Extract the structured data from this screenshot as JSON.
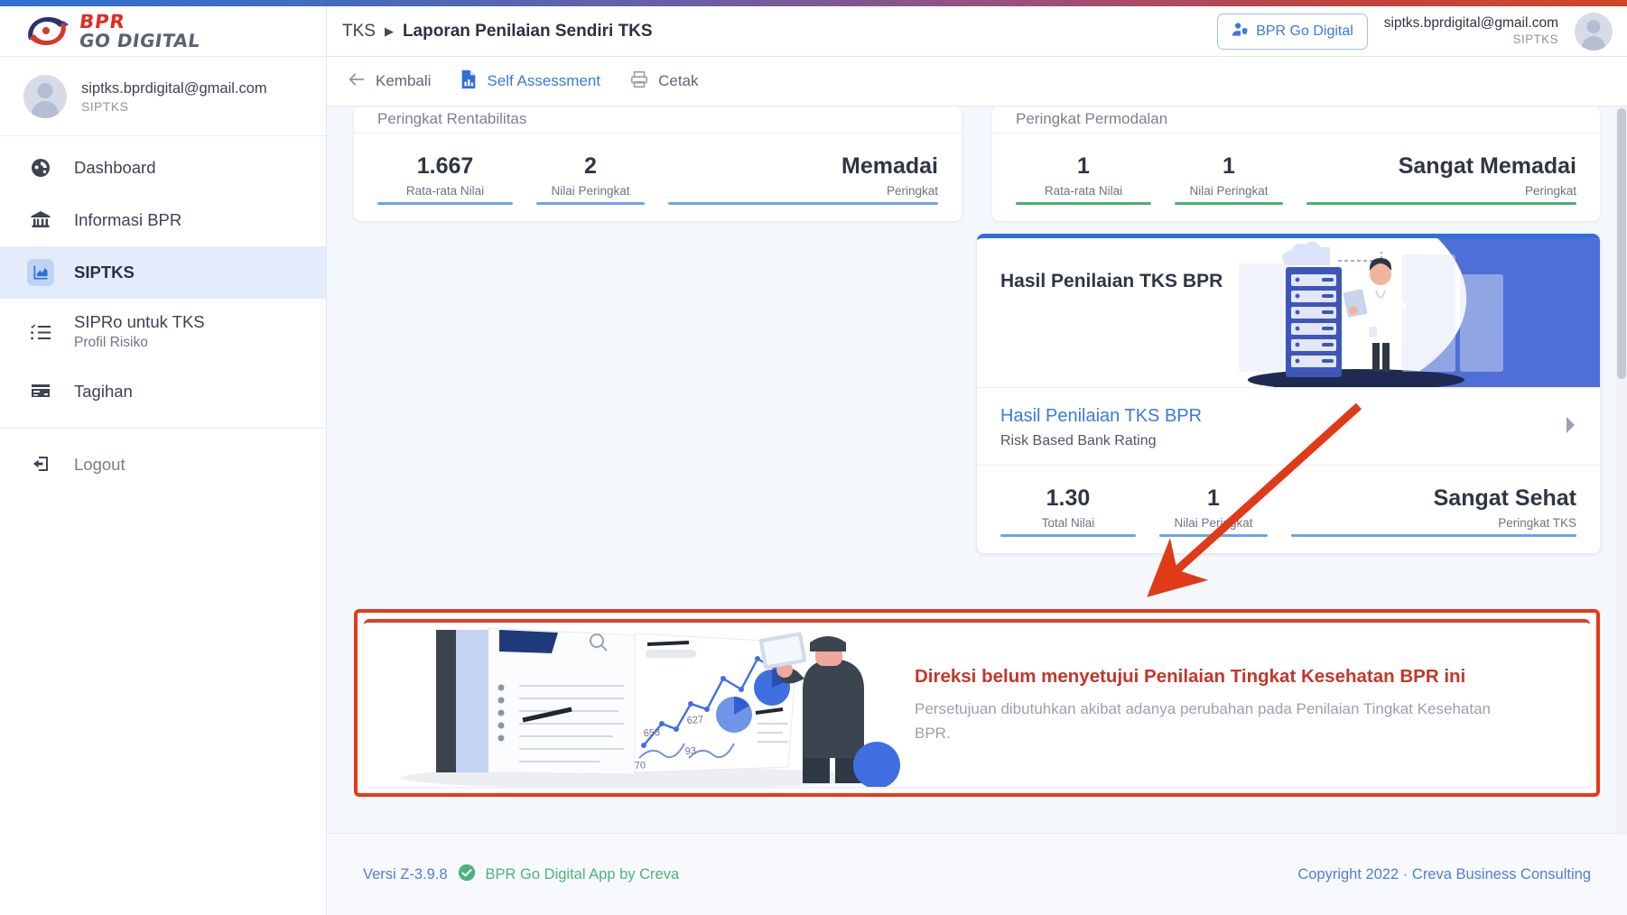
{
  "brand": {
    "line1": "BPR",
    "line2": "GO DIGITAL",
    "logo_icon": "bpr-swoosh-logo"
  },
  "sidebar": {
    "user": {
      "email": "siptks.bprdigital@gmail.com",
      "role": "SIPTKS",
      "avatar_icon": "user-avatar-icon"
    },
    "items": [
      {
        "label": "Dashboard",
        "icon": "dashboard-gauge-icon",
        "sub": "",
        "active": false
      },
      {
        "label": "Informasi BPR",
        "icon": "bank-building-icon",
        "sub": "",
        "active": false
      },
      {
        "label": "SIPTKS",
        "icon": "chart-area-icon",
        "sub": "",
        "active": true
      },
      {
        "label": "SIPRo untuk TKS",
        "icon": "checklist-icon",
        "sub": "Profil Risiko",
        "active": false
      },
      {
        "label": "Tagihan",
        "icon": "credit-card-icon",
        "sub": "",
        "active": false
      }
    ],
    "logout": {
      "label": "Logout",
      "icon": "logout-icon"
    }
  },
  "header": {
    "breadcrumb_root": "TKS",
    "breadcrumb_separator": "▶",
    "breadcrumb_leaf": "Laporan Penilaian Sendiri TKS",
    "go_digital_button": "BPR Go Digital",
    "go_digital_icon": "user-shield-icon",
    "user_email": "siptks.bprdigital@gmail.com",
    "user_role": "SIPTKS",
    "avatar_icon": "user-avatar-icon"
  },
  "toolbar": {
    "back": {
      "label": "Kembali",
      "icon": "arrow-left-icon"
    },
    "self_assessment": {
      "label": "Self Assessment",
      "icon": "document-chart-icon"
    },
    "print": {
      "label": "Cetak",
      "icon": "printer-icon"
    }
  },
  "colors": {
    "accent_blue": "#3a7ae0",
    "rule_blue": "#6fa3e8",
    "rule_green": "#4caf72",
    "annotation_red": "#e8391a",
    "alert_red": "#c4362a",
    "footer_green": "#4cb37e"
  },
  "stat_cards": [
    {
      "title": "Peringkat Rentabilitas",
      "rule_color": "#6fa3e8",
      "cells": [
        {
          "value": "1.667",
          "label": "Rata-rata Nilai",
          "align": "center",
          "width": "w1"
        },
        {
          "value": "2",
          "label": "Nilai Peringkat",
          "align": "center",
          "width": "w2"
        },
        {
          "value": "Memadai",
          "label": "Peringkat",
          "align": "right",
          "width": "grow"
        }
      ]
    },
    {
      "title": "Peringkat Permodalan",
      "rule_color": "#4caf72",
      "cells": [
        {
          "value": "1",
          "label": "Rata-rata Nilai",
          "align": "center",
          "width": "w1"
        },
        {
          "value": "1",
          "label": "Nilai Peringkat",
          "align": "center",
          "width": "w2"
        },
        {
          "value": "Sangat Memadai",
          "label": "Peringkat",
          "align": "right",
          "width": "grow"
        }
      ]
    }
  ],
  "result_card": {
    "hero_title": "Hasil Penilaian TKS BPR",
    "hero_illustration": "data-center-technician-illustration",
    "link_title": "Hasil Penilaian TKS BPR",
    "link_subtitle": "Risk Based Bank Rating",
    "chevron_icon": "chevron-right-icon",
    "rule_color": "#6fa3e8",
    "cells": [
      {
        "value": "1.30",
        "label": "Total Nilai",
        "align": "center",
        "width": "w1"
      },
      {
        "value": "1",
        "label": "Nilai Peringkat",
        "align": "center",
        "width": "w2"
      },
      {
        "value": "Sangat Sehat",
        "label": "Peringkat TKS",
        "align": "right",
        "width": "grow"
      }
    ]
  },
  "alert": {
    "title": "Direksi belum menyetujui Penilaian Tingkat Kesehatan BPR ini",
    "subtitle": "Persetujuan dibutuhkan akibat adanya perubahan pada Penilaian Tingkat Kesehatan BPR.",
    "illustration": "business-analytics-presentation-illustration"
  },
  "annotations": {
    "arrow": "red-arrow-pointing-to-alert",
    "highlight_box": "red-highlight-box-around-alert"
  },
  "footer": {
    "version": "Versi Z-3.9.8",
    "check_icon": "green-check-circle-icon",
    "app_name": "BPR Go Digital App by Creva",
    "copyright": "Copyright 2022 · Creva Business Consulting"
  },
  "scrollbar": {
    "icon": "vertical-scrollbar"
  }
}
